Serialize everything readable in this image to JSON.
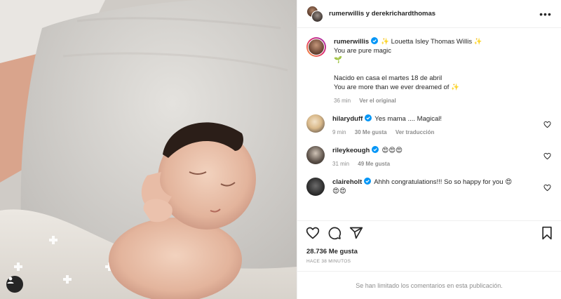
{
  "header": {
    "title": "rumerwillis y derekrichardthomas",
    "more_label": "•••"
  },
  "caption": {
    "username": "rumerwillis",
    "lines": [
      "✨ Louetta Isley Thomas Willis ✨",
      "You are pure magic",
      "🌱",
      "",
      "Nacido en casa el martes 18 de abril",
      "You are more than we ever dreamed of ✨"
    ],
    "time": "36 min",
    "see_original": "Ver el original"
  },
  "comments": [
    {
      "username": "hilaryduff",
      "text": "Yes mama .... Magical!",
      "time": "9 min",
      "likes": "30 Me gusta",
      "extra": "Ver traducción"
    },
    {
      "username": "rileykeough",
      "text": "😍😍😍",
      "time": "31 min",
      "likes": "49 Me gusta",
      "extra": ""
    },
    {
      "username": "claireholt",
      "text": "Ahhh congratulations!!! So so happy for you 😍",
      "text2": "😍😍",
      "time": "",
      "likes": "",
      "extra": ""
    }
  ],
  "actions": {
    "likes": "28.736 Me gusta",
    "posted": "HACE 38 MINUTOS"
  },
  "footer": {
    "limited": "Se han limitado los comentarios en esta publicación."
  },
  "colors": {
    "verified": "#0095f6",
    "text": "#262626",
    "muted": "#8e8e8e",
    "divider": "#efefef"
  },
  "icons": [
    "tag-person-icon",
    "more-options-icon",
    "verified-icon",
    "heart-icon",
    "comment-icon",
    "share-icon",
    "bookmark-icon"
  ]
}
